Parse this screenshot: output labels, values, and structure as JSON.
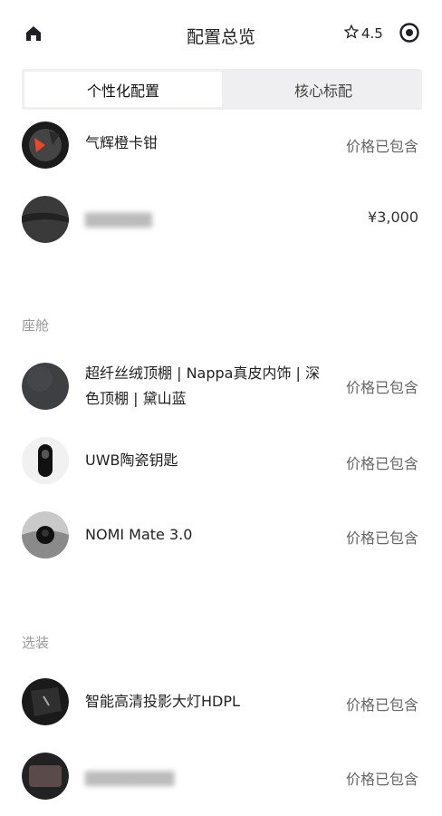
{
  "header": {
    "title": "配置总览",
    "rating": "4.5",
    "icons": {
      "home": "home-icon",
      "star": "star-icon",
      "target": "target-icon"
    }
  },
  "tabs": [
    {
      "label": "个性化配置",
      "active": true
    },
    {
      "label": "核心标配",
      "active": false
    }
  ],
  "items_top": [
    {
      "name": "气辉橙卡钳",
      "price": "价格已包含"
    },
    {
      "name": "▇▇▇▇▇▇",
      "price": "¥3,000"
    }
  ],
  "sections": [
    {
      "title": "座舱",
      "items": [
        {
          "name": "超纤丝绒顶棚 | Nappa真皮内饰 | 深色顶棚 | 黛山蓝",
          "price": "价格已包含"
        },
        {
          "name": "UWB陶瓷钥匙",
          "price": "价格已包含"
        },
        {
          "name": "NOMI Mate 3.0",
          "price": "价格已包含"
        }
      ]
    },
    {
      "title": "选装",
      "items": [
        {
          "name": "智能高清投影大灯HDPL",
          "price": "价格已包含"
        },
        {
          "name": "▇▇▇▇▇▇▇▇",
          "price": "价格已包含"
        }
      ]
    }
  ],
  "colors": {
    "accent": "#1f2026",
    "muted": "#999999",
    "tab_bg": "#efeff1"
  }
}
